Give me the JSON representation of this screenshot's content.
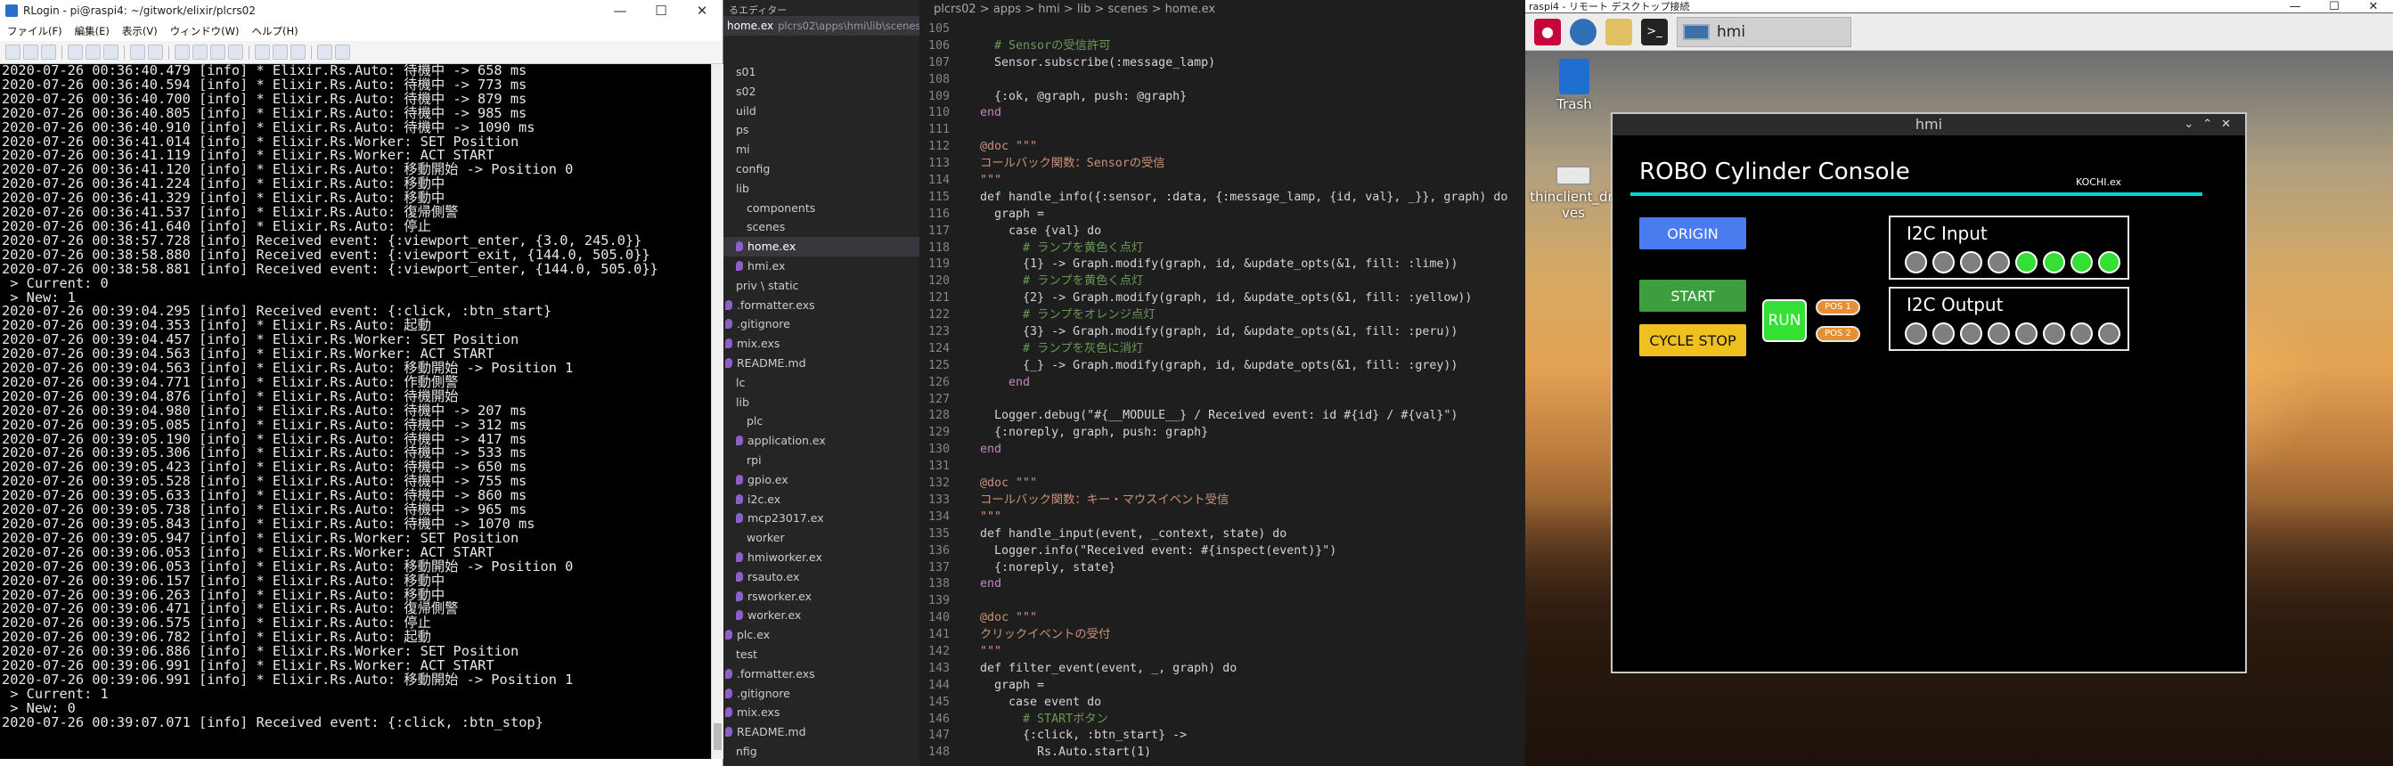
{
  "terminal": {
    "title": "RLogin - pi@raspi4: ~/gitwork/elixir/plcrs02",
    "menu": [
      "ファイル(F)",
      "編集(E)",
      "表示(V)",
      "ウィンドウ(W)",
      "ヘルプ(H)"
    ],
    "lines": [
      "2020-07-26 00:36:40.479 [info] * Elixir.Rs.Auto: 待機中 -> 658 ms",
      "2020-07-26 00:36:40.594 [info] * Elixir.Rs.Auto: 待機中 -> 773 ms",
      "2020-07-26 00:36:40.700 [info] * Elixir.Rs.Auto: 待機中 -> 879 ms",
      "2020-07-26 00:36:40.805 [info] * Elixir.Rs.Auto: 待機中 -> 985 ms",
      "2020-07-26 00:36:40.910 [info] * Elixir.Rs.Auto: 待機中 -> 1090 ms",
      "2020-07-26 00:36:41.014 [info] * Elixir.Rs.Worker: SET Position",
      "2020-07-26 00:36:41.119 [info] * Elixir.Rs.Worker: ACT START",
      "2020-07-26 00:36:41.120 [info] * Elixir.Rs.Auto: 移動開始 -> Position 0",
      "2020-07-26 00:36:41.224 [info] * Elixir.Rs.Auto: 移動中",
      "2020-07-26 00:36:41.329 [info] * Elixir.Rs.Auto: 移動中",
      "2020-07-26 00:36:41.537 [info] * Elixir.Rs.Auto: 復帰側警",
      "2020-07-26 00:36:41.640 [info] * Elixir.Rs.Auto: 停止",
      "2020-07-26 00:38:57.728 [info] Received event: {:viewport_enter, {3.0, 245.0}}",
      "2020-07-26 00:38:58.880 [info] Received event: {:viewport_exit, {144.0, 505.0}}",
      "2020-07-26 00:38:58.881 [info] Received event: {:viewport_enter, {144.0, 505.0}}",
      " > Current: 0",
      " > New: 1",
      "2020-07-26 00:39:04.295 [info] Received event: {:click, :btn_start}",
      "2020-07-26 00:39:04.353 [info] * Elixir.Rs.Auto: 起動",
      "2020-07-26 00:39:04.457 [info] * Elixir.Rs.Worker: SET Position",
      "2020-07-26 00:39:04.563 [info] * Elixir.Rs.Worker: ACT START",
      "2020-07-26 00:39:04.563 [info] * Elixir.Rs.Auto: 移動開始 -> Position 1",
      "2020-07-26 00:39:04.771 [info] * Elixir.Rs.Auto: 作動側警",
      "2020-07-26 00:39:04.876 [info] * Elixir.Rs.Auto: 待機開始",
      "2020-07-26 00:39:04.980 [info] * Elixir.Rs.Auto: 待機中 -> 207 ms",
      "2020-07-26 00:39:05.085 [info] * Elixir.Rs.Auto: 待機中 -> 312 ms",
      "2020-07-26 00:39:05.190 [info] * Elixir.Rs.Auto: 待機中 -> 417 ms",
      "2020-07-26 00:39:05.306 [info] * Elixir.Rs.Auto: 待機中 -> 533 ms",
      "2020-07-26 00:39:05.423 [info] * Elixir.Rs.Auto: 待機中 -> 650 ms",
      "2020-07-26 00:39:05.528 [info] * Elixir.Rs.Auto: 待機中 -> 755 ms",
      "2020-07-26 00:39:05.633 [info] * Elixir.Rs.Auto: 待機中 -> 860 ms",
      "2020-07-26 00:39:05.738 [info] * Elixir.Rs.Auto: 待機中 -> 965 ms",
      "2020-07-26 00:39:05.843 [info] * Elixir.Rs.Auto: 待機中 -> 1070 ms",
      "2020-07-26 00:39:05.947 [info] * Elixir.Rs.Worker: SET Position",
      "2020-07-26 00:39:06.053 [info] * Elixir.Rs.Worker: ACT START",
      "2020-07-26 00:39:06.053 [info] * Elixir.Rs.Auto: 移動開始 -> Position 0",
      "2020-07-26 00:39:06.157 [info] * Elixir.Rs.Auto: 移動中",
      "2020-07-26 00:39:06.263 [info] * Elixir.Rs.Auto: 移動中",
      "2020-07-26 00:39:06.471 [info] * Elixir.Rs.Auto: 復帰側警",
      "2020-07-26 00:39:06.575 [info] * Elixir.Rs.Auto: 停止",
      "2020-07-26 00:39:06.782 [info] * Elixir.Rs.Auto: 起動",
      "2020-07-26 00:39:06.886 [info] * Elixir.Rs.Worker: SET Position",
      "2020-07-26 00:39:06.991 [info] * Elixir.Rs.Worker: ACT START",
      "2020-07-26 00:39:06.991 [info] * Elixir.Rs.Auto: 移動開始 -> Position 1",
      " > Current: 1",
      " > New: 0",
      "2020-07-26 00:39:07.071 [info] Received event: {:click, :btn_stop}"
    ]
  },
  "sidebar": {
    "header": "るエディター",
    "open_file": "home.ex",
    "open_path": "plcrs02\\apps\\hmi\\lib\\scenes",
    "tree": [
      {
        "label": "s01",
        "indent": 0,
        "icon": false
      },
      {
        "label": "s02",
        "indent": 0,
        "icon": false
      },
      {
        "label": "uild",
        "indent": 0,
        "icon": false
      },
      {
        "label": "ps",
        "indent": 0,
        "icon": false
      },
      {
        "label": "mi",
        "indent": 0,
        "icon": false
      },
      {
        "label": "config",
        "indent": 0,
        "icon": false
      },
      {
        "label": "lib",
        "indent": 0,
        "icon": false
      },
      {
        "label": "components",
        "indent": 1,
        "icon": false
      },
      {
        "label": "scenes",
        "indent": 1,
        "icon": false
      },
      {
        "label": "home.ex",
        "indent": 1,
        "icon": true,
        "selected": true
      },
      {
        "label": "hmi.ex",
        "indent": 1,
        "icon": true
      },
      {
        "label": "priv \\ static",
        "indent": 0,
        "icon": false
      },
      {
        "label": ".formatter.exs",
        "indent": 0,
        "icon": true
      },
      {
        "label": ".gitignore",
        "indent": 0,
        "icon": true
      },
      {
        "label": "mix.exs",
        "indent": 0,
        "icon": true
      },
      {
        "label": "README.md",
        "indent": 0,
        "icon": true
      },
      {
        "label": "lc",
        "indent": 0,
        "icon": false
      },
      {
        "label": "lib",
        "indent": 0,
        "icon": false
      },
      {
        "label": "plc",
        "indent": 1,
        "icon": false
      },
      {
        "label": "application.ex",
        "indent": 1,
        "icon": true
      },
      {
        "label": "rpi",
        "indent": 1,
        "icon": false
      },
      {
        "label": "gpio.ex",
        "indent": 1,
        "icon": true
      },
      {
        "label": "i2c.ex",
        "indent": 1,
        "icon": true
      },
      {
        "label": "mcp23017.ex",
        "indent": 1,
        "icon": true
      },
      {
        "label": "worker",
        "indent": 1,
        "icon": false
      },
      {
        "label": "hmiworker.ex",
        "indent": 1,
        "icon": true
      },
      {
        "label": "rsauto.ex",
        "indent": 1,
        "icon": true
      },
      {
        "label": "rsworker.ex",
        "indent": 1,
        "icon": true
      },
      {
        "label": "worker.ex",
        "indent": 1,
        "icon": true
      },
      {
        "label": "plc.ex",
        "indent": 0,
        "icon": true
      },
      {
        "label": "test",
        "indent": 0,
        "icon": false
      },
      {
        "label": ".formatter.exs",
        "indent": 0,
        "icon": true
      },
      {
        "label": ".gitignore",
        "indent": 0,
        "icon": true
      },
      {
        "label": "mix.exs",
        "indent": 0,
        "icon": true
      },
      {
        "label": "README.md",
        "indent": 0,
        "icon": true
      },
      {
        "label": "nfig",
        "indent": 0,
        "icon": false
      }
    ]
  },
  "editor": {
    "breadcrumb": "plcrs02 > apps > hmi > lib > scenes > home.ex",
    "lines": [
      {
        "n": "105",
        "t": "",
        "k": ""
      },
      {
        "n": "106",
        "t": "    # Sensorの受信許可",
        "k": "cmt"
      },
      {
        "n": "107",
        "t": "    Sensor.subscribe(:message_lamp)",
        "k": ""
      },
      {
        "n": "108",
        "t": "",
        "k": ""
      },
      {
        "n": "109",
        "t": "    {:ok, @graph, push: @graph}",
        "k": ""
      },
      {
        "n": "110",
        "t": "  end",
        "k": "kw"
      },
      {
        "n": "111",
        "t": "",
        "k": ""
      },
      {
        "n": "112",
        "t": "  @doc \"\"\"",
        "k": "doc"
      },
      {
        "n": "113",
        "t": "  コールバック関数：Sensorの受信",
        "k": "doc"
      },
      {
        "n": "114",
        "t": "  \"\"\"",
        "k": "doc"
      },
      {
        "n": "115",
        "t": "  def handle_info({:sensor, :data, {:message_lamp, {id, val}, _}}, graph) do",
        "k": ""
      },
      {
        "n": "116",
        "t": "    graph =",
        "k": ""
      },
      {
        "n": "117",
        "t": "      case {val} do",
        "k": ""
      },
      {
        "n": "118",
        "t": "        # ランプを黄色く点灯",
        "k": "cmt"
      },
      {
        "n": "119",
        "t": "        {1} -> Graph.modify(graph, id, &update_opts(&1, fill: :lime))",
        "k": ""
      },
      {
        "n": "120",
        "t": "        # ランプを黄色く点灯",
        "k": "cmt"
      },
      {
        "n": "121",
        "t": "        {2} -> Graph.modify(graph, id, &update_opts(&1, fill: :yellow))",
        "k": ""
      },
      {
        "n": "122",
        "t": "        # ランプをオレンジ点灯",
        "k": "cmt"
      },
      {
        "n": "123",
        "t": "        {3} -> Graph.modify(graph, id, &update_opts(&1, fill: :peru))",
        "k": ""
      },
      {
        "n": "124",
        "t": "        # ランプを灰色に消灯",
        "k": "cmt"
      },
      {
        "n": "125",
        "t": "        {_} -> Graph.modify(graph, id, &update_opts(&1, fill: :grey))",
        "k": ""
      },
      {
        "n": "126",
        "t": "      end",
        "k": "kw"
      },
      {
        "n": "127",
        "t": "",
        "k": ""
      },
      {
        "n": "128",
        "t": "    Logger.debug(\"#{__MODULE__} / Received event: id #{id} / #{val}\")",
        "k": ""
      },
      {
        "n": "129",
        "t": "    {:noreply, graph, push: graph}",
        "k": ""
      },
      {
        "n": "130",
        "t": "  end",
        "k": "kw"
      },
      {
        "n": "131",
        "t": "",
        "k": ""
      },
      {
        "n": "132",
        "t": "  @doc \"\"\"",
        "k": "doc"
      },
      {
        "n": "133",
        "t": "  コールバック関数：キー・マウスイベント受信",
        "k": "doc"
      },
      {
        "n": "134",
        "t": "  \"\"\"",
        "k": "doc"
      },
      {
        "n": "135",
        "t": "  def handle_input(event, _context, state) do",
        "k": ""
      },
      {
        "n": "136",
        "t": "    Logger.info(\"Received event: #{inspect(event)}\")",
        "k": ""
      },
      {
        "n": "137",
        "t": "    {:noreply, state}",
        "k": ""
      },
      {
        "n": "138",
        "t": "  end",
        "k": "kw"
      },
      {
        "n": "139",
        "t": "",
        "k": ""
      },
      {
        "n": "140",
        "t": "  @doc \"\"\"",
        "k": "doc"
      },
      {
        "n": "141",
        "t": "  クリックイベントの受付",
        "k": "doc"
      },
      {
        "n": "142",
        "t": "  \"\"\"",
        "k": "doc"
      },
      {
        "n": "143",
        "t": "  def filter_event(event, _, graph) do",
        "k": ""
      },
      {
        "n": "144",
        "t": "    graph =",
        "k": ""
      },
      {
        "n": "145",
        "t": "      case event do",
        "k": ""
      },
      {
        "n": "146",
        "t": "        # STARTボタン",
        "k": "cmt"
      },
      {
        "n": "147",
        "t": "        {:click, :btn_start} ->",
        "k": ""
      },
      {
        "n": "148",
        "t": "          Rs.Auto.start(1)",
        "k": ""
      }
    ]
  },
  "remote": {
    "title": "raspi4 - リモート デスクトップ接続",
    "taskbar_label": "hmi",
    "desktop_icons": [
      "Trash",
      "thinclient_drives"
    ],
    "hmi": {
      "window_title": "hmi",
      "app_title": "ROBO Cylinder Console",
      "kochi": "KOCHI.ex",
      "origin": "ORIGIN",
      "start": "START",
      "cycle_stop": "CYCLE STOP",
      "run": "RUN",
      "pos1": "POS 1",
      "pos2": "POS 2",
      "i2c_input": "I2C Input",
      "i2c_output": "I2C Output",
      "input_leds": [
        false,
        false,
        false,
        false,
        true,
        true,
        true,
        true
      ],
      "output_leds": [
        false,
        false,
        false,
        false,
        false,
        false,
        false,
        false
      ],
      "colors": {
        "origin": "#4a7cf0",
        "start": "#3c9e3c",
        "cycle_stop": "#f0c020",
        "run": "#33e033",
        "pos": "#e88f33",
        "cyan": "#00d4d4"
      }
    }
  }
}
